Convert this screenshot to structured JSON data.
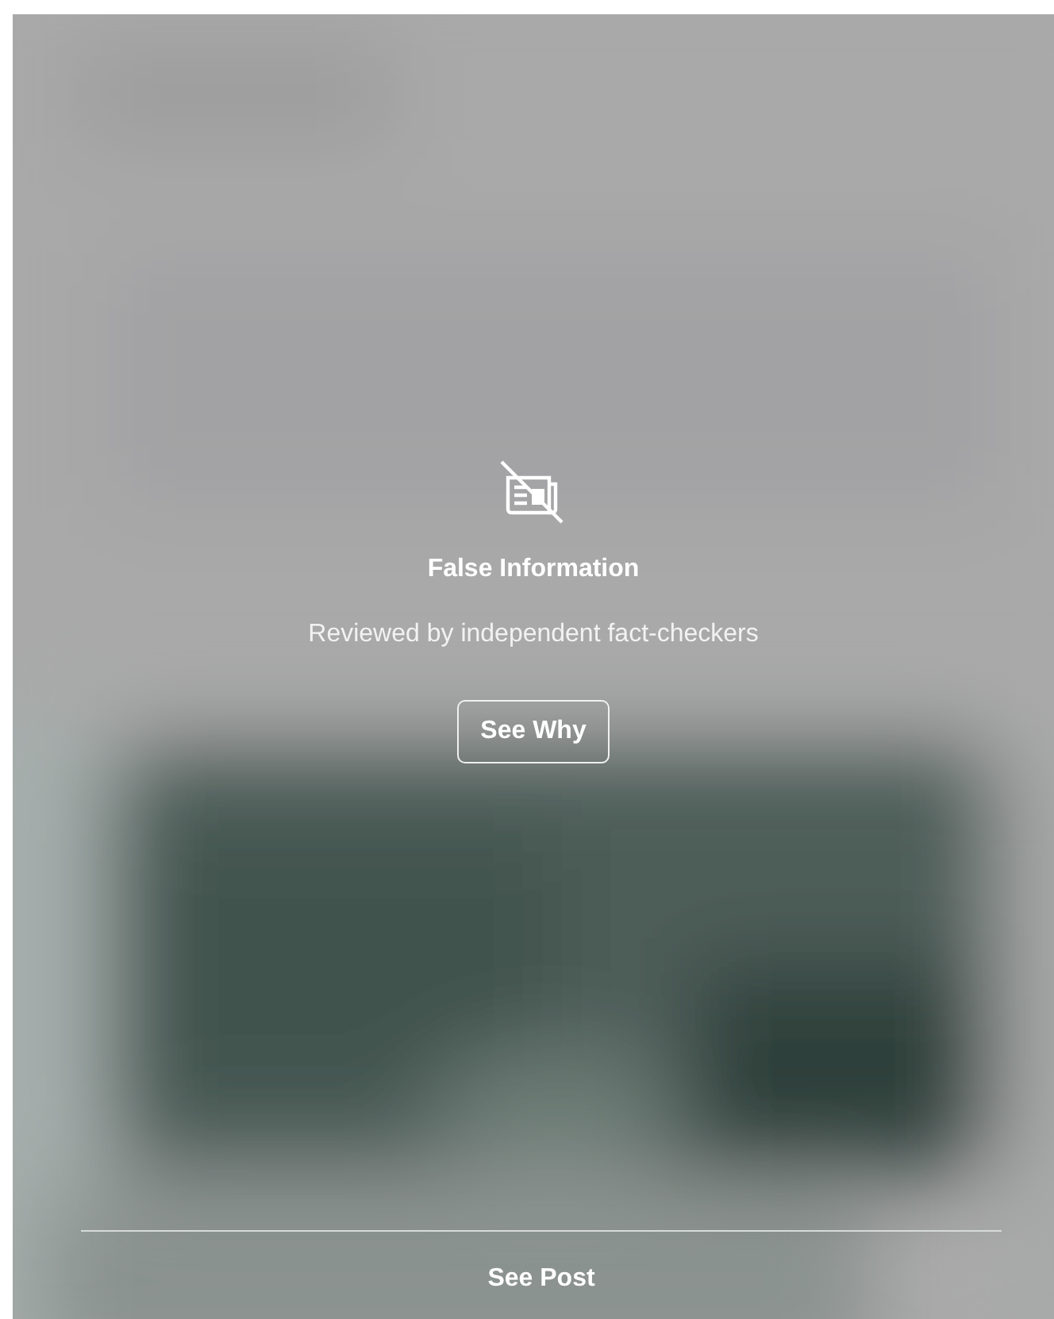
{
  "notice": {
    "title": "False Information",
    "subtitle": "Reviewed by independent fact-checkers"
  },
  "button": {
    "label": "See Why"
  },
  "footer": {
    "link": "See Post"
  }
}
